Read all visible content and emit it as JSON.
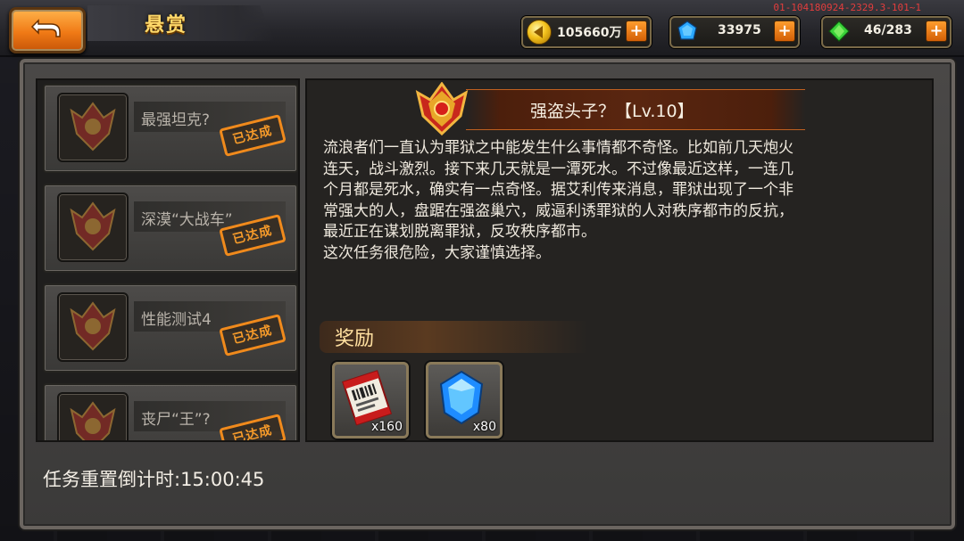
{
  "header": {
    "title": "悬赏",
    "version": "01-104180924-2329.3-101~1",
    "resources": [
      {
        "icon": "coin-icon",
        "value": "105660万"
      },
      {
        "icon": "blue-diamond-icon",
        "value": "33975"
      },
      {
        "icon": "green-gem-icon",
        "value": "46/283"
      }
    ]
  },
  "quests": [
    {
      "name": "最强坦克?",
      "status": "已达成"
    },
    {
      "name": "深漠“大战车”",
      "status": "已达成"
    },
    {
      "name": "性能测试4",
      "status": "已达成"
    },
    {
      "name": "丧尸“王”?",
      "status": "已达成"
    }
  ],
  "detail": {
    "title": "强盗头子？【Lv.10】",
    "description_lines": [
      "流浪者们一直认为罪狱之中能发生什么事情都不奇怪。比如前几天炮火",
      "连天，战斗激烈。接下来几天就是一潭死水。不过像最近这样，一连几",
      "个月都是死水，确实有一点奇怪。据艾利传来消息，罪狱出现了一个非",
      "常强大的人，盘踞在强盗巢穴，威逼利诱罪狱的人对秩序都市的反抗，",
      "最近正在谋划脱离罪狱，反攻秩序都市。",
      "这次任务很危险，大家谨慎选择。"
    ],
    "reward_label": "奖励",
    "rewards": [
      {
        "icon": "ticket-scroll-icon",
        "count": "x160"
      },
      {
        "icon": "blue-crystal-icon",
        "count": "x80"
      }
    ]
  },
  "footer": {
    "countdown": "任务重置倒计时:15:00:45"
  }
}
